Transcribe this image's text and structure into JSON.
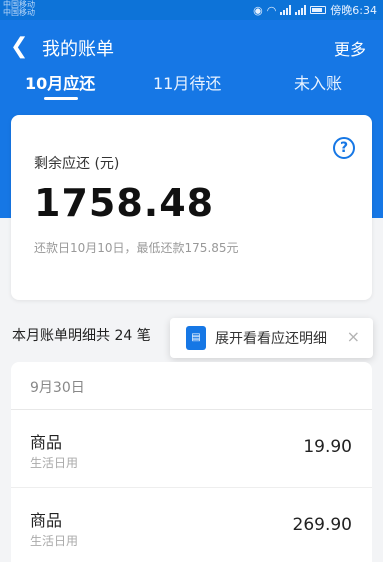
{
  "status_bar": {
    "carrier_1": "中国移动",
    "carrier_2": "中国移动",
    "time_label": "傍晚6:34"
  },
  "header": {
    "title": "我的账单",
    "more_label": "更多",
    "tabs": [
      {
        "label": "10月应还",
        "active": true
      },
      {
        "label": "11月待还",
        "active": false
      },
      {
        "label": "未入账",
        "active": false
      }
    ]
  },
  "summary": {
    "remaining_label": "剩余应还 (元)",
    "amount": "1758.48",
    "due_info": "还款日10月10日，最低还款175.85元"
  },
  "details": {
    "count_label": "本月账单明细共 24 笔",
    "banner_text": "展开看看应还明细",
    "date": "9月30日",
    "items": [
      {
        "name": "商品",
        "category": "生活日用",
        "amount": "19.90"
      },
      {
        "name": "商品",
        "category": "生活日用",
        "amount": "269.90"
      }
    ]
  },
  "colors": {
    "accent": "#1677e5",
    "status_bar": "#0d73d8",
    "background": "#f3f4f6"
  },
  "icons": [
    "back-arrow-icon",
    "help-circle-icon",
    "receipt-icon",
    "close-icon",
    "signal-icon",
    "wifi-icon",
    "battery-icon"
  ]
}
